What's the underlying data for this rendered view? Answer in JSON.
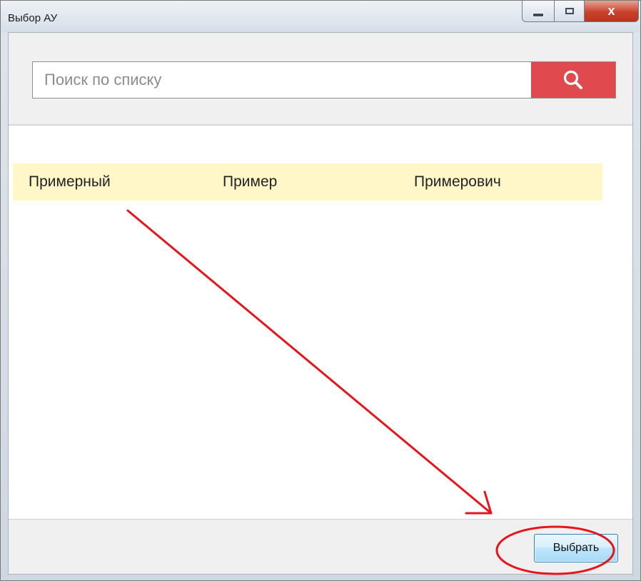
{
  "window": {
    "title": "Выбор АУ",
    "close_glyph": "x"
  },
  "search": {
    "placeholder": "Поиск по списку",
    "value": ""
  },
  "list": {
    "rows": [
      {
        "last_name": "Примерный",
        "first_name": "Пример",
        "patronymic": "Примерович"
      }
    ]
  },
  "footer": {
    "select_label": "Выбрать"
  },
  "colors": {
    "search_button": "#e04a4e",
    "selected_row": "#fff7c8",
    "annotation": "#e8141b"
  },
  "icons": [
    "minimize-icon",
    "maximize-icon",
    "close-icon",
    "search-icon"
  ]
}
